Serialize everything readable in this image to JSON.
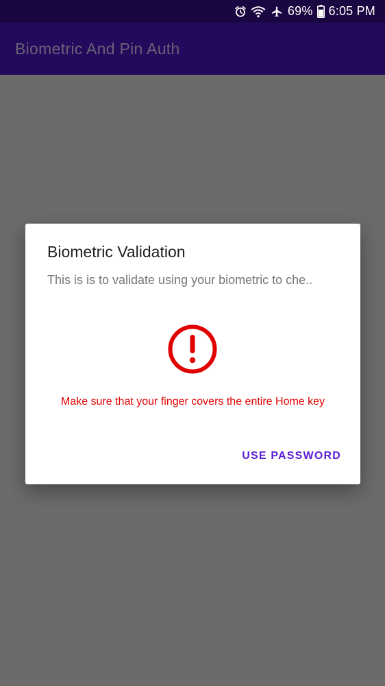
{
  "status_bar": {
    "icons": [
      "alarm-icon",
      "wifi-icon",
      "airplane-mode-icon",
      "battery-icon"
    ],
    "battery_percent": "69%",
    "time": "6:05 PM"
  },
  "app_bar": {
    "title": "Biometric And Pin Auth"
  },
  "dialog": {
    "title": "Biometric Validation",
    "description": "This is is to validate using your biometric to che..",
    "icon": "error-icon",
    "error_message": "Make sure that your finger covers the entire Home key",
    "negative_button": "USE PASSWORD"
  },
  "colors": {
    "status_bar_bg": "#1a0640",
    "app_bar_bg": "#24095c",
    "scrim": "#6b6b6b",
    "error_red": "#e00000",
    "accent": "#5b1bd6"
  }
}
